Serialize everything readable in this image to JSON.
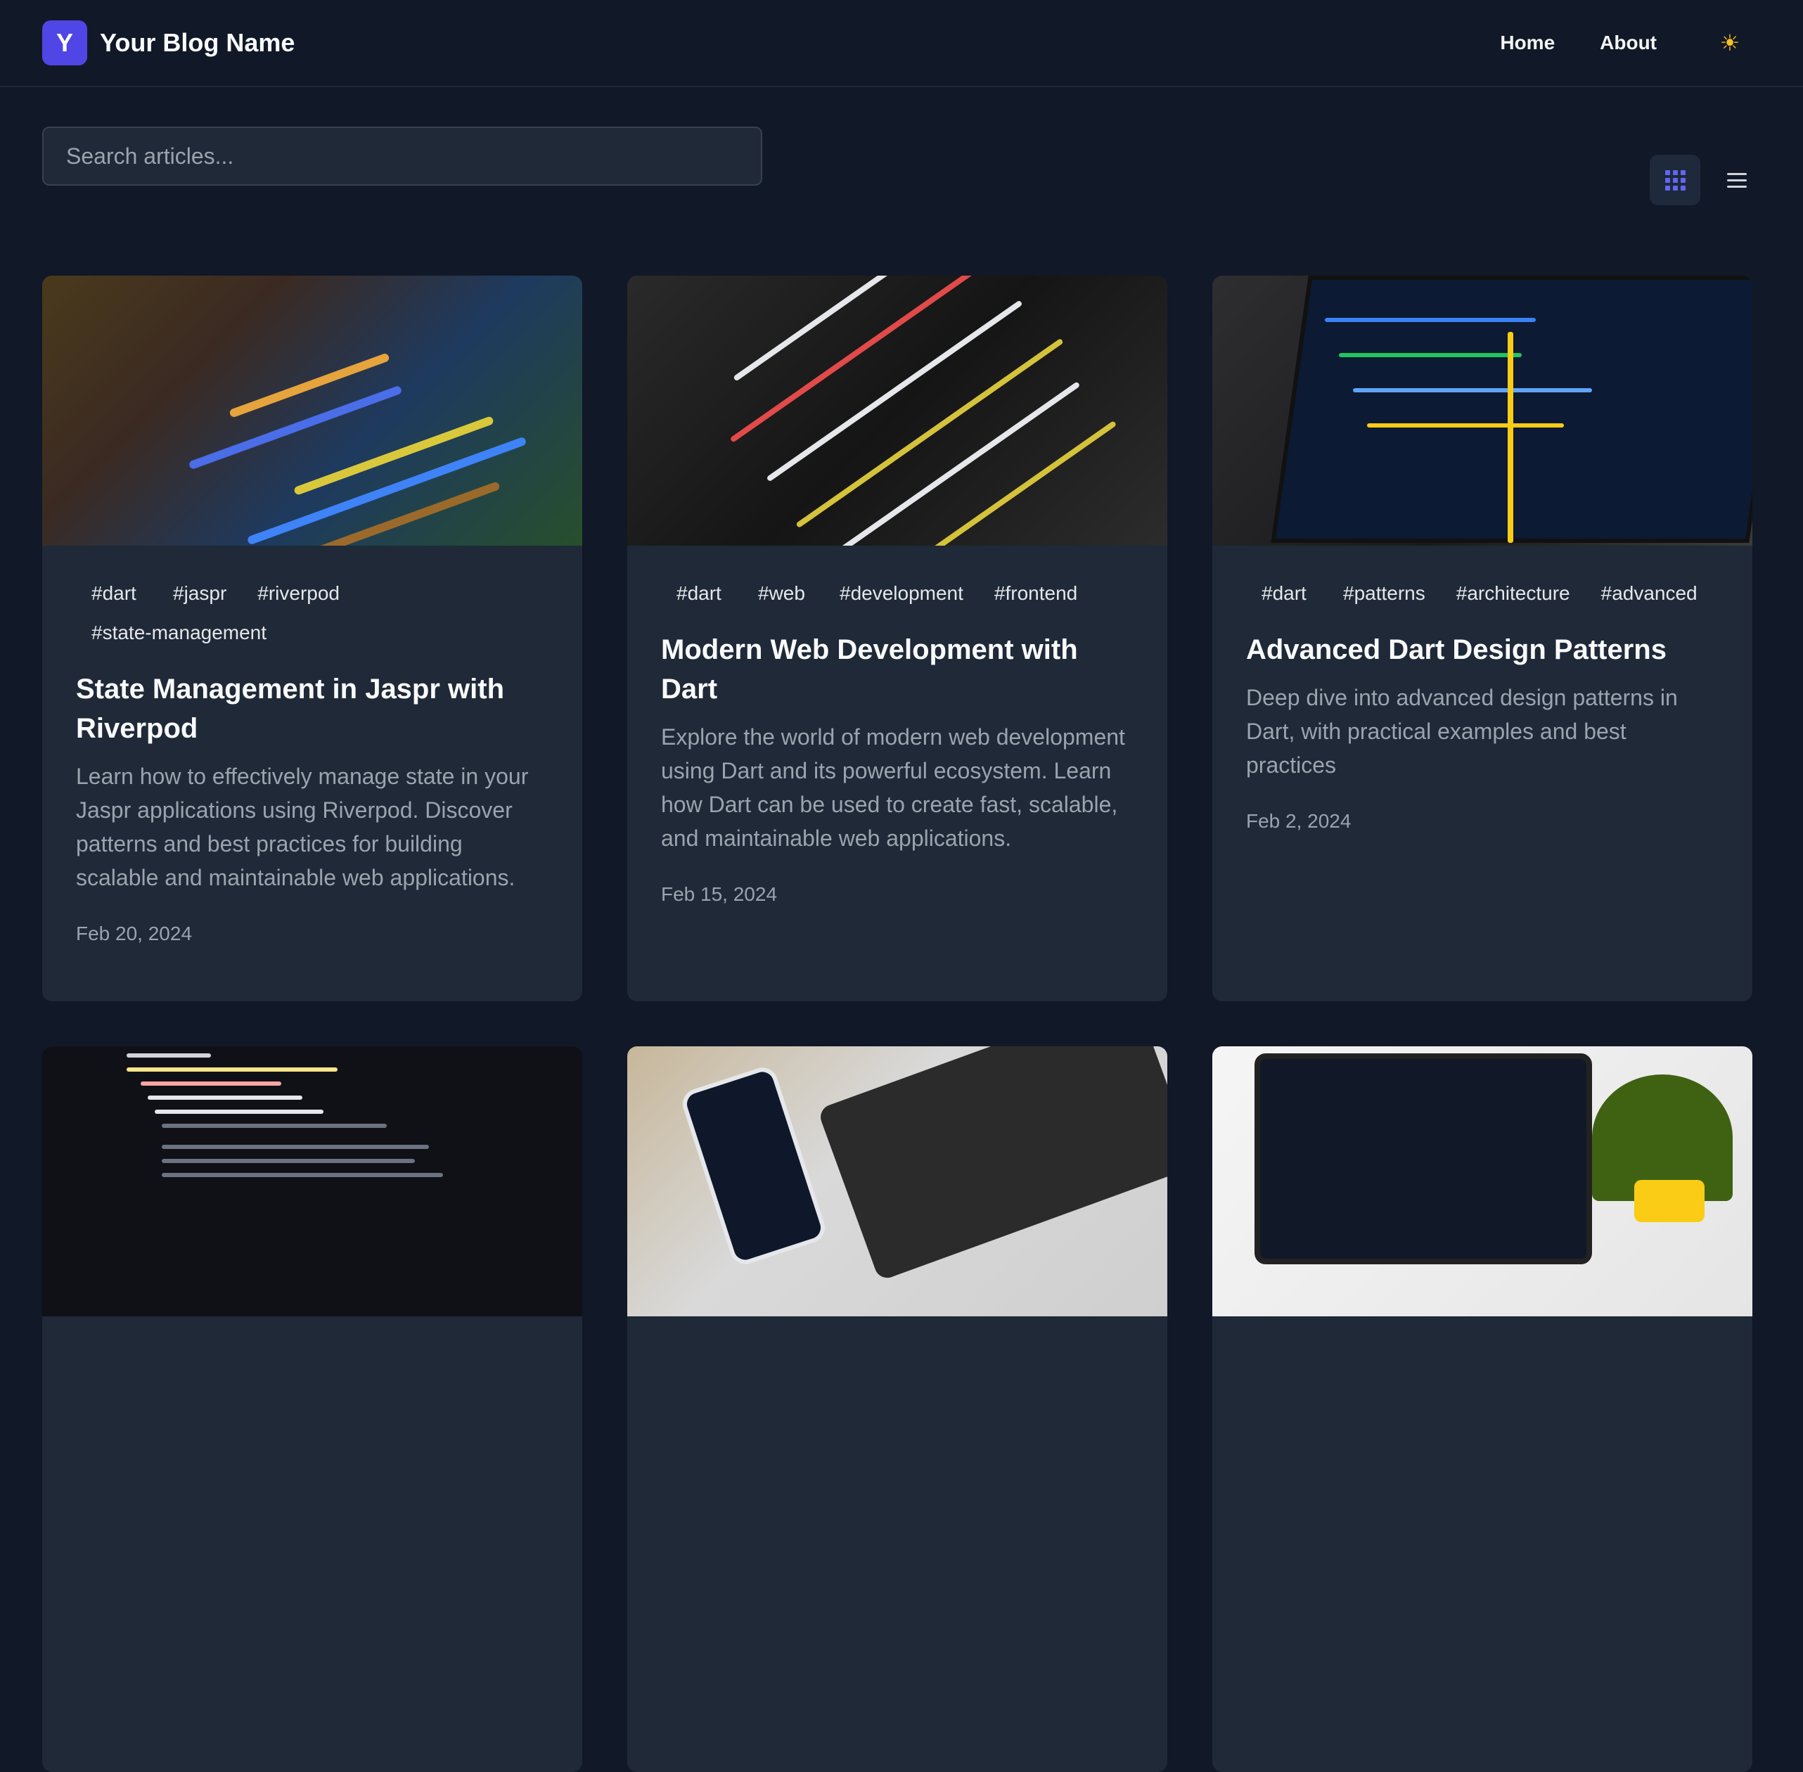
{
  "header": {
    "logo_letter": "Y",
    "brand_name": "Your Blog Name",
    "nav": [
      {
        "label": "Home"
      },
      {
        "label": "About"
      }
    ],
    "theme_icon": "sun-icon",
    "theme_glyph": "☀"
  },
  "search": {
    "placeholder": "Search articles...",
    "value": ""
  },
  "view_toggle": {
    "active": "grid",
    "options": [
      "grid-icon",
      "list-icon"
    ]
  },
  "articles": [
    {
      "tags": [
        "#dart",
        "#jaspr",
        "#riverpod",
        "#state-management"
      ],
      "title": "State Management in Jaspr with Riverpod",
      "description": "Learn how to effectively manage state in your Jaspr applications using Riverpod. Discover patterns and best practices for building scalable and maintainable web applications.",
      "date": "Feb 20, 2024"
    },
    {
      "tags": [
        "#dart",
        "#web",
        "#development",
        "#frontend"
      ],
      "title": "Modern Web Development with Dart",
      "description": "Explore the world of modern web development using Dart and its powerful ecosystem. Learn how Dart can be used to create fast, scalable, and maintainable web applications.",
      "date": "Feb 15, 2024"
    },
    {
      "tags": [
        "#dart",
        "#patterns",
        "#architecture",
        "#advanced"
      ],
      "title": "Advanced Dart Design Patterns",
      "description": "Deep dive into advanced design patterns in Dart, with practical examples and best practices",
      "date": "Feb 2, 2024"
    },
    {
      "tags": [],
      "title": "",
      "description": "",
      "date": ""
    },
    {
      "tags": [],
      "title": "",
      "description": "",
      "date": ""
    },
    {
      "tags": [],
      "title": "",
      "description": "",
      "date": ""
    }
  ],
  "colors": {
    "background": "#111827",
    "card": "#1f2937",
    "accent": "#4f46e5",
    "muted_text": "#9ca3af"
  }
}
